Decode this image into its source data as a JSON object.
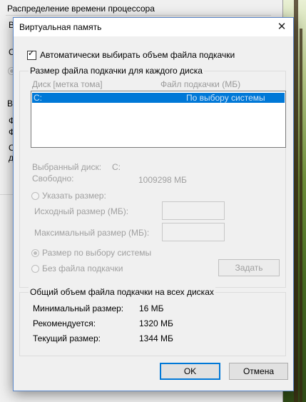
{
  "background_window": {
    "group_title": "Распределение времени процессора",
    "fragments": [
      "В",
      "С",
      "В",
      "Ф",
      "Ф",
      "О",
      "д"
    ]
  },
  "dialog": {
    "title": "Виртуальная память",
    "close_glyph": "✕",
    "auto_manage": {
      "label": "Автоматически выбирать объем файла подкачки",
      "checked": true
    },
    "per_drive_group": {
      "title": "Размер файла подкачки для каждого диска",
      "col_drive": "Диск [метка тома]",
      "col_size": "Файл подкачки (МБ)",
      "rows": [
        {
          "drive": "C:",
          "size": "По выбору системы",
          "selected": true
        }
      ],
      "selected_drive_label": "Выбранный диск:",
      "selected_drive_value": "C:",
      "free_label": "Свободно:",
      "free_value": "1009298 МБ",
      "custom_size_label": "Указать размер:",
      "initial_size_label": "Исходный размер (МБ):",
      "max_size_label": "Максимальный размер (МБ):",
      "system_managed_label": "Размер по выбору системы",
      "no_paging_label": "Без файла подкачки",
      "set_button": "Задать"
    },
    "total_group": {
      "title": "Общий объем файла подкачки на всех дисках",
      "min_label": "Минимальный размер:",
      "min_value": "16 МБ",
      "recommended_label": "Рекомендуется:",
      "recommended_value": "1320 МБ",
      "current_label": "Текущий размер:",
      "current_value": "1344 МБ"
    },
    "ok_button": "OK",
    "cancel_button": "Отмена"
  },
  "colors": {
    "accent": "#0078d7",
    "disabled_text": "#a0a0a0",
    "dialog_bg": "#f0f0f0"
  }
}
